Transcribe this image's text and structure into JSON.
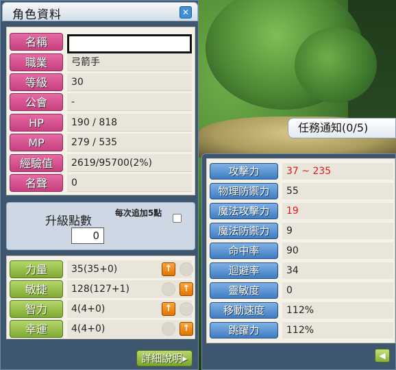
{
  "window": {
    "title": "角色資料",
    "close_icon": "close-icon"
  },
  "info": [
    {
      "label": "名稱",
      "value": ""
    },
    {
      "label": "職業",
      "value": "弓箭手"
    },
    {
      "label": "等級",
      "value": "30"
    },
    {
      "label": "公會",
      "value": "-"
    },
    {
      "label": "HP",
      "value": "190 / 818"
    },
    {
      "label": "MP",
      "value": "279 / 535"
    },
    {
      "label": "經驗值",
      "value": "2619/95700(2%)"
    },
    {
      "label": "名聲",
      "value": "0"
    }
  ],
  "levelup": {
    "label": "升級點數",
    "bonus_label": "每次追加5點",
    "points": "0"
  },
  "stats": [
    {
      "label": "力量",
      "value": "35(35+0)"
    },
    {
      "label": "敏捷",
      "value": "128(127+1)"
    },
    {
      "label": "智力",
      "value": "4(4+0)"
    },
    {
      "label": "幸運",
      "value": "4(4+0)"
    }
  ],
  "detail_button": "詳細說明",
  "quest_notice": "任務通知(0/5)",
  "abilities": [
    {
      "label": "攻擊力",
      "value": "37 ~ 235",
      "color": "#e01818"
    },
    {
      "label": "物理防禦力",
      "value": "55"
    },
    {
      "label": "魔法攻擊力",
      "value": "19",
      "color": "#e01818"
    },
    {
      "label": "魔法防禦力",
      "value": "9"
    },
    {
      "label": "命中率",
      "value": "90"
    },
    {
      "label": "迴避率",
      "value": "34"
    },
    {
      "label": "靈敏度",
      "value": "0"
    },
    {
      "label": "移動速度",
      "value": "112%"
    },
    {
      "label": "跳躍力",
      "value": "112%"
    }
  ],
  "colors": {
    "panel_bg": "#3e566f",
    "label_pink": "#c73f7f",
    "label_green": "#7faa32",
    "label_blue": "#3f7cc2",
    "highlight_red": "#e01818",
    "up_button_orange": "#e07400"
  }
}
